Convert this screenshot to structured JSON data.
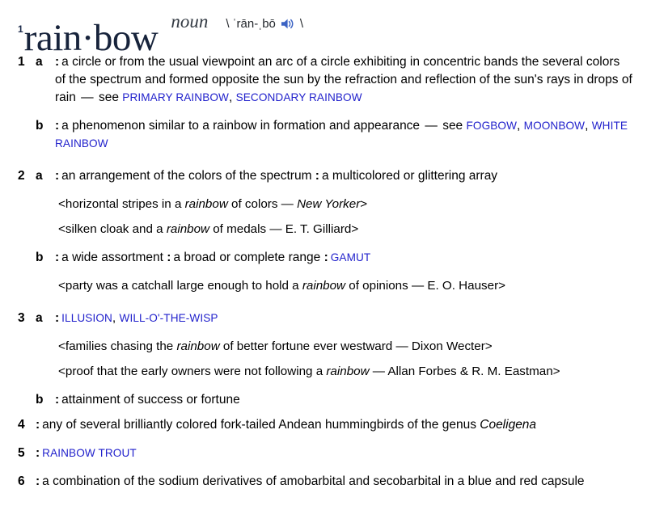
{
  "entry": {
    "homograph": "1",
    "headword": "rain·bow",
    "part_of_speech": "noun",
    "pronunciation_open": "\\",
    "pronunciation": "ˈrān-ˌbō",
    "pronunciation_close": "\\",
    "audio_icon": "speaker-icon",
    "link_color": "#2222cc",
    "headword_color": "#17233b"
  },
  "senses": [
    {
      "number": "1",
      "subsenses": [
        {
          "letter": "a",
          "colon": ":",
          "text": "a circle or from the usual viewpoint an arc of a circle exhibiting in concentric bands the several colors of the spectrum and formed opposite the sun by the refraction and reflection of the sun's rays in drops of rain",
          "dash": "—",
          "see_label": "see",
          "xrefs": [
            "PRIMARY RAINBOW",
            "SECONDARY RAINBOW"
          ],
          "examples": []
        },
        {
          "letter": "b",
          "colon": ":",
          "text": "a phenomenon similar to a rainbow in formation and appearance",
          "dash": "—",
          "see_label": "see",
          "xrefs": [
            "FOGBOW",
            "MOONBOW",
            "WHITE RAINBOW"
          ],
          "examples": []
        }
      ]
    },
    {
      "number": "2",
      "subsenses": [
        {
          "letter": "a",
          "colon": ":",
          "text": "an arrangement of the colors of the spectrum",
          "colon2": ":",
          "text2": "a multicolored or glittering array",
          "xrefs": [],
          "examples": [
            {
              "open": "<",
              "pre": "horizontal stripes in a ",
              "italic_word": "rainbow",
              "post": " of colors ",
              "dash": "—",
              "citation": "New Yorker",
              "close": ">"
            },
            {
              "open": "<",
              "pre": "silken cloak and a ",
              "italic_word": "rainbow",
              "post": " of medals ",
              "dash": "—",
              "citation": "E. T. Gilliard",
              "close": ">"
            }
          ]
        },
        {
          "letter": "b",
          "colon": ":",
          "text": "a wide assortment",
          "colon2": ":",
          "text2": "a broad or complete range",
          "colon3": ":",
          "xrefs": [
            "GAMUT"
          ],
          "examples": [
            {
              "open": "<",
              "pre": "party was a catchall large enough to hold a ",
              "italic_word": "rainbow",
              "post": " of opinions ",
              "dash": "—",
              "citation": "E. O. Hauser",
              "close": ">"
            }
          ]
        }
      ]
    },
    {
      "number": "3",
      "subsenses": [
        {
          "letter": "a",
          "colon": ":",
          "text": "",
          "xrefs": [
            "ILLUSION",
            "WILL-O'-THE-WISP"
          ],
          "examples": [
            {
              "open": "<",
              "pre": "families chasing the ",
              "italic_word": "rainbow",
              "post": " of better fortune ever westward ",
              "dash": "—",
              "citation": "Dixon Wecter",
              "close": ">",
              "citation_italic": false
            },
            {
              "open": "<",
              "pre": "proof that the early owners were not following a ",
              "italic_word": "rainbow",
              "post": " ",
              "dash": "—",
              "citation": "Allan Forbes & R. M. Eastman",
              "close": ">",
              "citation_italic": false
            }
          ]
        },
        {
          "letter": "b",
          "colon": ":",
          "text": "attainment of success or fortune",
          "xrefs": [],
          "examples": []
        }
      ]
    },
    {
      "number": "4",
      "colon": ":",
      "text_pre": "any of several brilliantly colored fork-tailed Andean hummingbirds of the genus ",
      "genus": "Coeligena",
      "xrefs": [],
      "subsenses": []
    },
    {
      "number": "5",
      "colon": ":",
      "xrefs": [
        "RAINBOW TROUT"
      ],
      "subsenses": []
    },
    {
      "number": "6",
      "colon": ":",
      "text_pre": "a combination of the sodium derivatives of amobarbital and secobarbital in a blue and red capsule",
      "xrefs": [],
      "subsenses": []
    }
  ]
}
